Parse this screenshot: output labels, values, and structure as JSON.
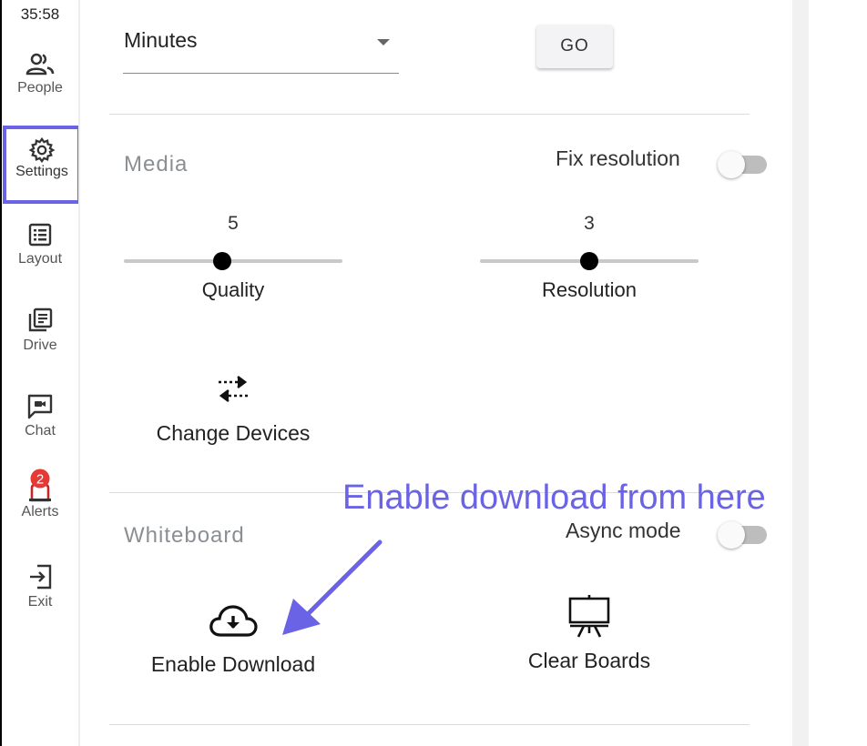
{
  "sidebar": {
    "timer": "35:58",
    "items": [
      {
        "label": "People",
        "icon": "people-icon"
      },
      {
        "label": "Settings",
        "icon": "gear-icon",
        "active": true
      },
      {
        "label": "Layout",
        "icon": "layout-icon"
      },
      {
        "label": "Drive",
        "icon": "drive-icon"
      },
      {
        "label": "Chat",
        "icon": "chat-icon"
      },
      {
        "label": "Alerts",
        "icon": "alerts-icon",
        "badge": "2"
      },
      {
        "label": "Exit",
        "icon": "exit-icon"
      }
    ]
  },
  "extend": {
    "select_value": "Minutes",
    "go_label": "GO"
  },
  "media": {
    "title": "Media",
    "fix_resolution_label": "Fix resolution",
    "fix_resolution_on": false,
    "quality": {
      "value": "5",
      "label": "Quality",
      "fraction": 0.45
    },
    "resolution": {
      "value": "3",
      "label": "Resolution",
      "fraction": 0.5
    },
    "change_devices_label": "Change Devices"
  },
  "whiteboard": {
    "title": "Whiteboard",
    "async_mode_label": "Async mode",
    "async_mode_on": false,
    "enable_download_label": "Enable Download",
    "clear_boards_label": "Clear Boards"
  },
  "annotation": {
    "text": "Enable download from here"
  },
  "colors": {
    "accent": "#6b63e6",
    "badge": "#e53935"
  }
}
